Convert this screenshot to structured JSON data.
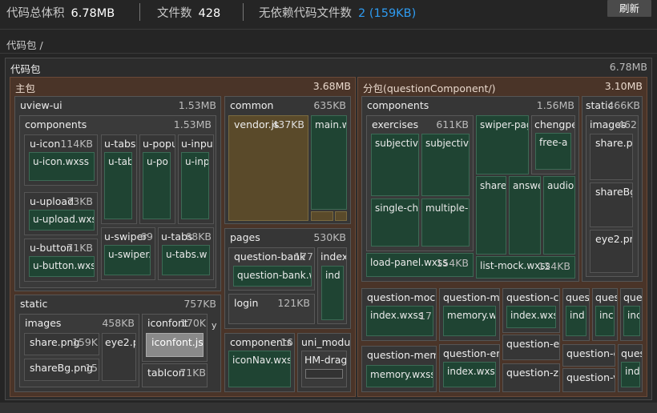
{
  "stats": {
    "size_label": "代码总体积",
    "size_value": "6.78MB",
    "files_label": "文件数",
    "files_value": "428",
    "nodep_label": "无依赖代码文件数",
    "nodep_value": "2 (159KB)"
  },
  "refresh_label": "刷新",
  "breadcrumb": "代码包 /",
  "root": {
    "name": "代码包",
    "size": "6.78MB"
  },
  "main": {
    "name": "主包",
    "size": "3.68MB"
  },
  "sub": {
    "name": "分包(questionComponent/)",
    "size": "3.10MB"
  },
  "uview": {
    "name": "uview-ui",
    "size": "1.53MB"
  },
  "uview_comp": {
    "name": "components",
    "size": "1.53MB"
  },
  "uicon": {
    "name": "u-icon",
    "size": "114KB",
    "file": "u-icon.wxss"
  },
  "uupload": {
    "name": "u-upload",
    "size": "73KB",
    "file": "u-upload.wxss"
  },
  "ubutton": {
    "name": "u-button",
    "size": "71KB",
    "file": "u-button.wxss"
  },
  "utabs_s": {
    "name": "u-tabs-s",
    "file": "u-tab"
  },
  "upopup": {
    "name": "u-popu",
    "file": "u-po"
  },
  "uinput": {
    "name": "u-input",
    "file": "u-inp"
  },
  "uswiper": {
    "name": "u-swiper",
    "size": "69",
    "file": "u-swiper."
  },
  "utabs": {
    "name": "u-tabs",
    "size": "68KB",
    "file": "u-tabs.w"
  },
  "static": {
    "name": "static",
    "size": "757KB"
  },
  "images": {
    "name": "images",
    "size": "458KB"
  },
  "share_png": {
    "name": "share.png",
    "size": "159K"
  },
  "sharebg_png": {
    "name": "shareBg.png",
    "size": "15"
  },
  "eye2": {
    "name": "eye2.p"
  },
  "iconfont": {
    "name": "iconfont",
    "size": "170K",
    "file": "iconfont.js1"
  },
  "tabicon": {
    "name": "tabIcon",
    "size": "71KB"
  },
  "y_label": "y",
  "common": {
    "name": "common",
    "size": "635KB"
  },
  "vendor": {
    "name": "vendor.js",
    "size": "437KB"
  },
  "mainw": {
    "name": "main.w"
  },
  "pages": {
    "name": "pages",
    "size": "530KB"
  },
  "qbank": {
    "name": "question-bank",
    "size": "177",
    "file": "question-bank.w"
  },
  "index_p": {
    "name": "index",
    "file": "ind"
  },
  "login": {
    "name": "login",
    "size": "121KB"
  },
  "components_main": {
    "name": "components",
    "size": "16",
    "file": "iconNav.wxs"
  },
  "unimod": {
    "name": "uni_module",
    "file": "HM-drag"
  },
  "sub_comp": {
    "name": "components",
    "size": "1.56MB"
  },
  "exercises": {
    "name": "exercises",
    "size": "611KB"
  },
  "subjective1": "subjective",
  "subjective2": "subjective",
  "singlech": "single-ch",
  "multiple": "multiple-c",
  "swiperpag": "swiper-pag",
  "chengpe": {
    "name": "chengpe",
    "file": "free-a"
  },
  "share_c": "share-",
  "answe": "answe",
  "audio": "audio-",
  "loadpanel": {
    "name": "load-panel.wxss",
    "size": "154KB"
  },
  "listmock": {
    "name": "list-mock.wxss",
    "size": "124KB"
  },
  "static_sub": {
    "name": "static",
    "size": "466KB"
  },
  "images_sub": {
    "name": "images",
    "size": "462"
  },
  "share_pr": "share.pr",
  "sharebg2": "shareBg",
  "eye2png": "eye2.png",
  "qmock": {
    "name": "question-mock-",
    "file": "index.wxss",
    "size": "17"
  },
  "qme": {
    "name": "question-me",
    "file": "memory.ws"
  },
  "qch": {
    "name": "question-ch",
    "file": "index.wxs"
  },
  "ques1": {
    "name": "ques",
    "file": "ind"
  },
  "ques2": {
    "name": "ques",
    "file": "inc"
  },
  "ques3": {
    "name": "ques",
    "file": "inc"
  },
  "qmemo": {
    "name": "question-memo",
    "file": "memory.wxss"
  },
  "qerr": {
    "name": "question-err",
    "file": "index.wxss"
  },
  "qex": "question-ex",
  "qzh": "question-zh",
  "qc": "question-c",
  "qv": "question-v",
  "ques4": {
    "name": "ques",
    "file": "ind"
  }
}
